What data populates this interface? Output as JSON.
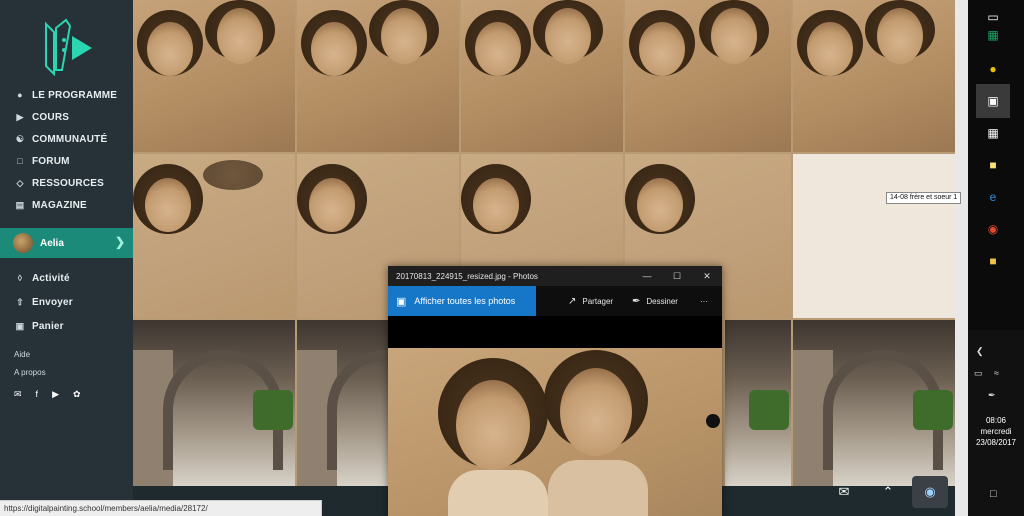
{
  "sidebar": {
    "nav": [
      {
        "label": "LE PROGRAMME",
        "icon": "bulb-icon"
      },
      {
        "label": "COURS",
        "icon": "play-icon"
      },
      {
        "label": "COMMUNAUTÉ",
        "icon": "people-icon"
      },
      {
        "label": "FORUM",
        "icon": "chat-icon"
      },
      {
        "label": "RESSOURCES",
        "icon": "layers-icon"
      },
      {
        "label": "MAGAZINE",
        "icon": "magazine-icon"
      }
    ],
    "user": {
      "name": "Aelia"
    },
    "sub_nav": [
      {
        "label": "Activité",
        "icon": "bell-icon"
      },
      {
        "label": "Envoyer",
        "icon": "upload-icon"
      },
      {
        "label": "Panier",
        "icon": "cart-icon"
      }
    ],
    "help": "Aide",
    "about": "A propos"
  },
  "tooltip": "14-08 frère et soeur 1",
  "photos_window": {
    "title": "20170813_224915_resized.jpg - Photos",
    "view_all": "Afficher toutes les photos",
    "share": "Partager",
    "draw": "Dessiner",
    "more": "···"
  },
  "status_url": "https://digitalpainting.school/members/aelia/media/28172/",
  "clock": {
    "time": "08:06",
    "day": "mercredi",
    "date": "23/08/2017"
  },
  "colors": {
    "sidebar_bg": "#263238",
    "accent": "#1b8a78",
    "photos_blue": "#1677c9"
  }
}
